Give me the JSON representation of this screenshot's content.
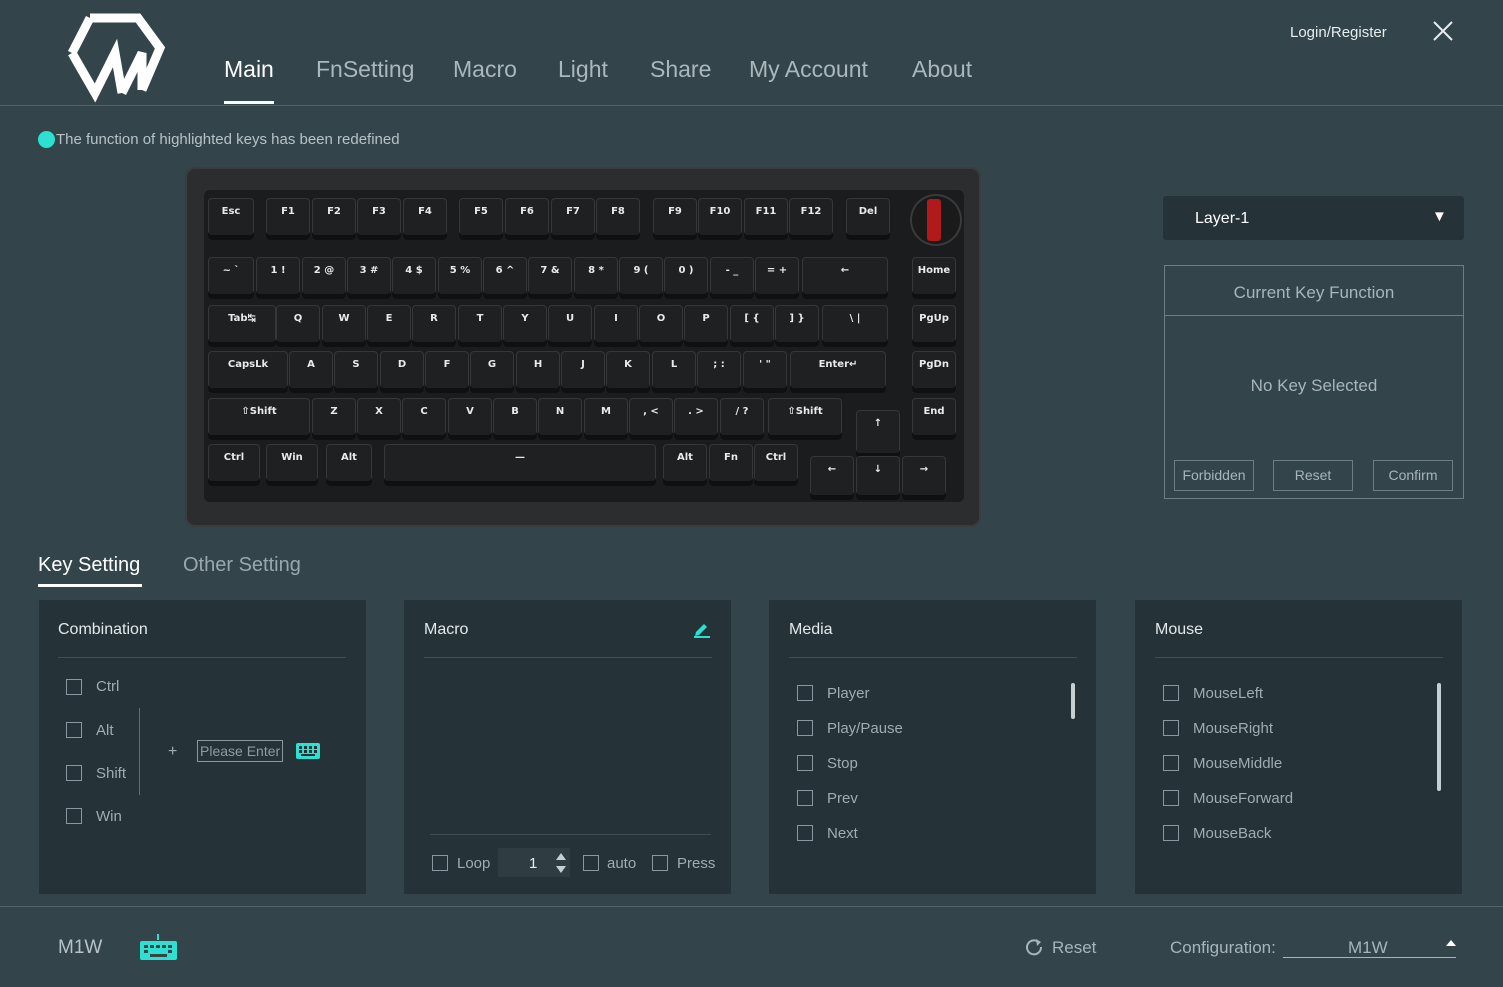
{
  "header": {
    "nav": [
      {
        "label": "Main",
        "active": true
      },
      {
        "label": "FnSetting",
        "active": false
      },
      {
        "label": "Macro",
        "active": false
      },
      {
        "label": "Light",
        "active": false
      },
      {
        "label": "Share",
        "active": false
      },
      {
        "label": "My Account",
        "active": false
      },
      {
        "label": "About",
        "active": false
      }
    ],
    "login_label": "Login/Register",
    "close_icon": "close-icon"
  },
  "notice": {
    "text": "The function of highlighted keys has been redefined",
    "dot_color": "#2ee0d0"
  },
  "keyboard": {
    "rows": [
      [
        "Esc",
        "F1",
        "F2",
        "F3",
        "F4",
        "F5",
        "F6",
        "F7",
        "F8",
        "F9",
        "F10",
        "F11",
        "F12",
        "Del"
      ],
      [
        "~ `",
        "1 !",
        "2 @",
        "3 #",
        "4 $",
        "5 %",
        "6 ^",
        "7 &",
        "8 *",
        "9 (",
        "0 )",
        "- _",
        "= +",
        "←",
        "Home"
      ],
      [
        "Tab↹",
        "Q",
        "W",
        "E",
        "R",
        "T",
        "Y",
        "U",
        "I",
        "O",
        "P",
        "[ {",
        "] }",
        "\\ |",
        "PgUp"
      ],
      [
        "CapsLk",
        "A",
        "S",
        "D",
        "F",
        "G",
        "H",
        "J",
        "K",
        "L",
        "; :",
        "' \"",
        "Enter↵",
        "PgDn"
      ],
      [
        "⇧Shift",
        "Z",
        "X",
        "C",
        "V",
        "B",
        "N",
        "M",
        ", <",
        ". >",
        "/ ?",
        "⇧Shift",
        "↑",
        "End"
      ],
      [
        "Ctrl",
        "Win",
        "Alt",
        "—",
        "Alt",
        "Fn",
        "Ctrl",
        "←",
        "↓",
        "→"
      ]
    ],
    "knob_color": "#b01a1a"
  },
  "layer": {
    "selected": "Layer-1",
    "caret": "▼"
  },
  "key_function": {
    "title": "Current Key Function",
    "status": "No Key Selected",
    "buttons": [
      "Forbidden",
      "Reset",
      "Confirm"
    ]
  },
  "setting_tabs": [
    {
      "label": "Key Setting",
      "active": true
    },
    {
      "label": "Other Setting",
      "active": false
    }
  ],
  "panels": {
    "combination": {
      "title": "Combination",
      "modifiers": [
        "Ctrl",
        "Alt",
        "Shift",
        "Win"
      ],
      "plus": "+",
      "input_placeholder": "Please Enter",
      "keyboard_icon": "keyboard-icon"
    },
    "macro": {
      "title": "Macro",
      "edit_icon": "pencil-icon",
      "loop_label": "Loop",
      "loop_count": "1",
      "auto_label": "auto",
      "press_label": "Press"
    },
    "media": {
      "title": "Media",
      "items": [
        "Player",
        "Play/Pause",
        "Stop",
        "Prev",
        "Next"
      ]
    },
    "mouse": {
      "title": "Mouse",
      "items": [
        "MouseLeft",
        "MouseRight",
        "MouseMiddle",
        "MouseForward",
        "MouseBack"
      ]
    }
  },
  "footer": {
    "device": "M1W",
    "keyboard_icon": "keyboard-icon",
    "reset_label": "Reset",
    "config_label": "Configuration:",
    "config_value": "M1W"
  },
  "colors": {
    "background": "#33454b",
    "panel": "#253338",
    "accent": "#2ee0d0"
  }
}
